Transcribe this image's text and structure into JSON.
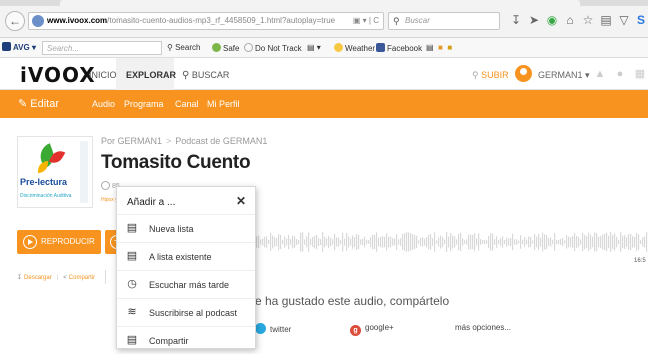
{
  "browser": {
    "url_domain": "www.ivoox.com",
    "url_path": "/tomasito-cuento-audios-mp3_rf_4458509_1.html?autoplay=true",
    "search_placeholder": "Buscar"
  },
  "toolbar": {
    "avg_label": "AVG",
    "search_placeholder": "Search...",
    "search_label": "Search",
    "safe_label": "Safe",
    "dnt_label": "Do Not Track",
    "weather_label": "Weather",
    "facebook_label": "Facebook"
  },
  "site": {
    "logo": "iVOOX",
    "nav": [
      "INICIO",
      "EXPLORAR",
      "BUSCAR"
    ],
    "upload_label": "SUBIR",
    "username": "GERMAN1"
  },
  "subnav": {
    "edit_label": "Editar",
    "links": [
      "Audio",
      "Programa",
      "Canal",
      "Mi Perfil"
    ]
  },
  "content": {
    "breadcrumb_author": "Por GERMAN1",
    "breadcrumb_podcast": "Podcast de GERMAN1",
    "title": "Tomasito Cuento",
    "thumb_brand": "Pre-lectura",
    "thumb_sub": "Discriminación Auditiva",
    "meta_text": "85",
    "meta_link": "Hipox y es",
    "play_label": "REPRODUCIR",
    "duration": "16:5",
    "download_label": "Descargar",
    "share_label": "Compartir",
    "share_heading": "e ha gustado este audio, compártelo",
    "share_twitter": "twitter",
    "share_google": "google+",
    "share_more": "más opciones..."
  },
  "popup": {
    "title": "Añadir a ...",
    "items": [
      {
        "label": "Nueva lista",
        "icon": "list-add-icon"
      },
      {
        "label": "A lista existente",
        "icon": "list-existing-icon"
      },
      {
        "label": "Escuchar más tarde",
        "icon": "clock-icon"
      },
      {
        "label": "Suscribirse al podcast",
        "icon": "rss-icon"
      },
      {
        "label": "Compartir",
        "icon": "share-list-icon"
      }
    ]
  },
  "colors": {
    "brand_orange": "#f7931e",
    "twitter": "#29a9e1",
    "google": "#dd4b39"
  }
}
